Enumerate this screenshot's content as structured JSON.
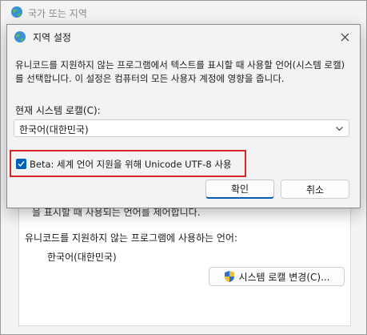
{
  "parent": {
    "title": "국가 또는 지역",
    "cut_text": "을 표시할 때 사용되는 언어를 제어합니다.",
    "section_label": "유니코드를 지원하지 않는 프로그램에 사용하는 언어:",
    "language_value": "한국어(대한민국)",
    "change_locale_button": "시스템 로캘 변경(C)..."
  },
  "dialog": {
    "title": "지역 설정",
    "description": "유니코드를 지원하지 않는 프로그램에서 텍스트를 표시할 때 사용할 언어(시스템 로캘)를 선택합니다. 이 설정은 컴퓨터의 모든 사용자 계정에 영향을 줍니다.",
    "locale_label": "현재 시스템 로캘(C):",
    "locale_value": "한국어(대한민국)",
    "beta_label": "Beta: 세계 언어 지원을 위해 Unicode UTF-8 사용",
    "beta_checked": true,
    "ok_label": "확인",
    "cancel_label": "취소"
  },
  "colors": {
    "accent": "#005fb8",
    "highlight_border": "#d7262c"
  }
}
